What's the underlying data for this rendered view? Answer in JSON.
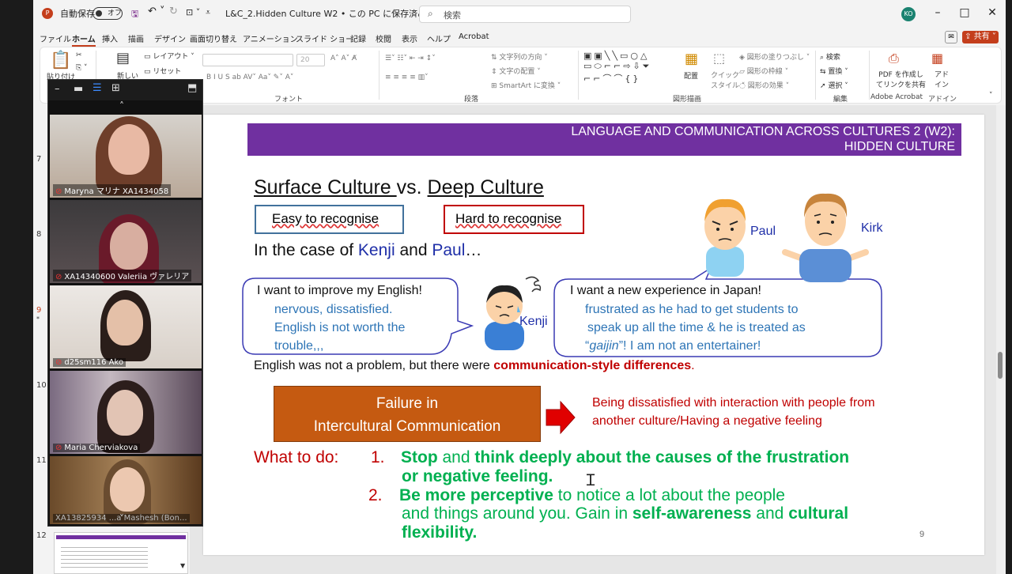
{
  "titlebar": {
    "autosave": "自動保存",
    "toggle": "オフ",
    "filename": "L&C_2.Hidden Culture W2 • この PC に保存済み",
    "search": "検索",
    "avatar": "KO"
  },
  "menu": [
    "ファイル",
    "ホーム",
    "挿入",
    "描画",
    "デザイン",
    "画面切り替え",
    "アニメーション",
    "スライド ショー",
    "記録",
    "校閲",
    "表示",
    "ヘルプ",
    "Acrobat"
  ],
  "share": "共有",
  "ribbon": {
    "paste": "貼り付け",
    "new_slide": "新しい",
    "layout": "レイアウト",
    "reset": "リセット",
    "font_size": "20",
    "font_label": "フォント",
    "paragraph_label": "段落",
    "drawing_label": "図形描画",
    "edit_label": "編集",
    "acrobat_label": "Adobe Acrobat",
    "addin_label": "アドイン",
    "text_dir": "文字列の方向",
    "text_align": "文字の配置",
    "smartart": "SmartArt に変換",
    "arrange": "配置",
    "quick": "クイック",
    "style": "スタイル",
    "fill": "図形の塗りつぶし",
    "outline": "図形の枠線",
    "effect": "図形の効果",
    "find": "検索",
    "replace": "置換",
    "select": "選択",
    "pdf1": "PDF を作成し",
    "pdf2": "てリンクを共有",
    "addin1": "アド",
    "addin2": "イン"
  },
  "thumb_numbers": [
    "7",
    "8",
    "9",
    "10",
    "11",
    "12"
  ],
  "zoom": {
    "participants": [
      {
        "name": "Maryna マリナ XA1434058"
      },
      {
        "name": "XA14340600 Valeriia ヴァレリア"
      },
      {
        "name": "d25sm116 Ako"
      },
      {
        "name": "Maria Cherviakova"
      },
      {
        "name": "XA13825934 ...a Mashesh (Bon..."
      }
    ]
  },
  "slide": {
    "header1": "LANGUAGE AND COMMUNICATION ACROSS CULTURES 2 (W2):",
    "header2": "HIDDEN CULTURE",
    "title_a": "Surface Culture ",
    "title_b": "vs. ",
    "title_c": "Deep Culture",
    "easy": "Easy to recognise",
    "hard": "Hard  to recognise",
    "case_a": "In the case of ",
    "kenji": "Kenji",
    "case_and": " and ",
    "paul": "Paul",
    "case_end": "…",
    "bubble_left": {
      "line1": "I want to improve my English!",
      "line2": "nervous, dissatisfied.",
      "line3": "English is not worth the",
      "line4": "trouble,,,"
    },
    "bubble_right": {
      "line1": "I want a new experience in Japan!",
      "line2": "frustrated as he had to get students to",
      "line3": "speak up all the time & he is treated as",
      "q1": "“",
      "gaijin": "gaijin",
      "q2": "”!   I am not an entertainer!"
    },
    "label_kenji": "Kenji",
    "label_paul": "Paul",
    "label_kirk": "Kirk",
    "english_a": "English was not a problem, but there were ",
    "english_b": "communication-style differences",
    ".": ".",
    "failure1": "Failure in",
    "failure2": "Intercultural Communication",
    "dissat1": "Being dissatisfied with interaction with people from",
    "dissat2": "another culture/Having a negative feeling",
    "what": "What to do:",
    "n1": "1.",
    "s1a": "Stop",
    "s1b": " and ",
    "s1c": "think deeply about the causes of the frustration",
    "s1d": "or negative feeling.",
    "n2": "2.",
    "s2a": "Be more perceptive",
    "s2b": " to notice a lot about the people",
    "s2c": "and things around you. Gain in ",
    "s2d": "self-awareness",
    "s2e": " and ",
    "s2f": "cultural",
    "s2g": "flexibility.",
    "page": "9"
  },
  "colors": {
    "header": "#7030a0",
    "blue": "#1f2fa8",
    "teal": "#2e75b6",
    "green": "#00b050",
    "red": "#c00000",
    "orange": "#c55a11",
    "accent": "#c43e1c"
  }
}
